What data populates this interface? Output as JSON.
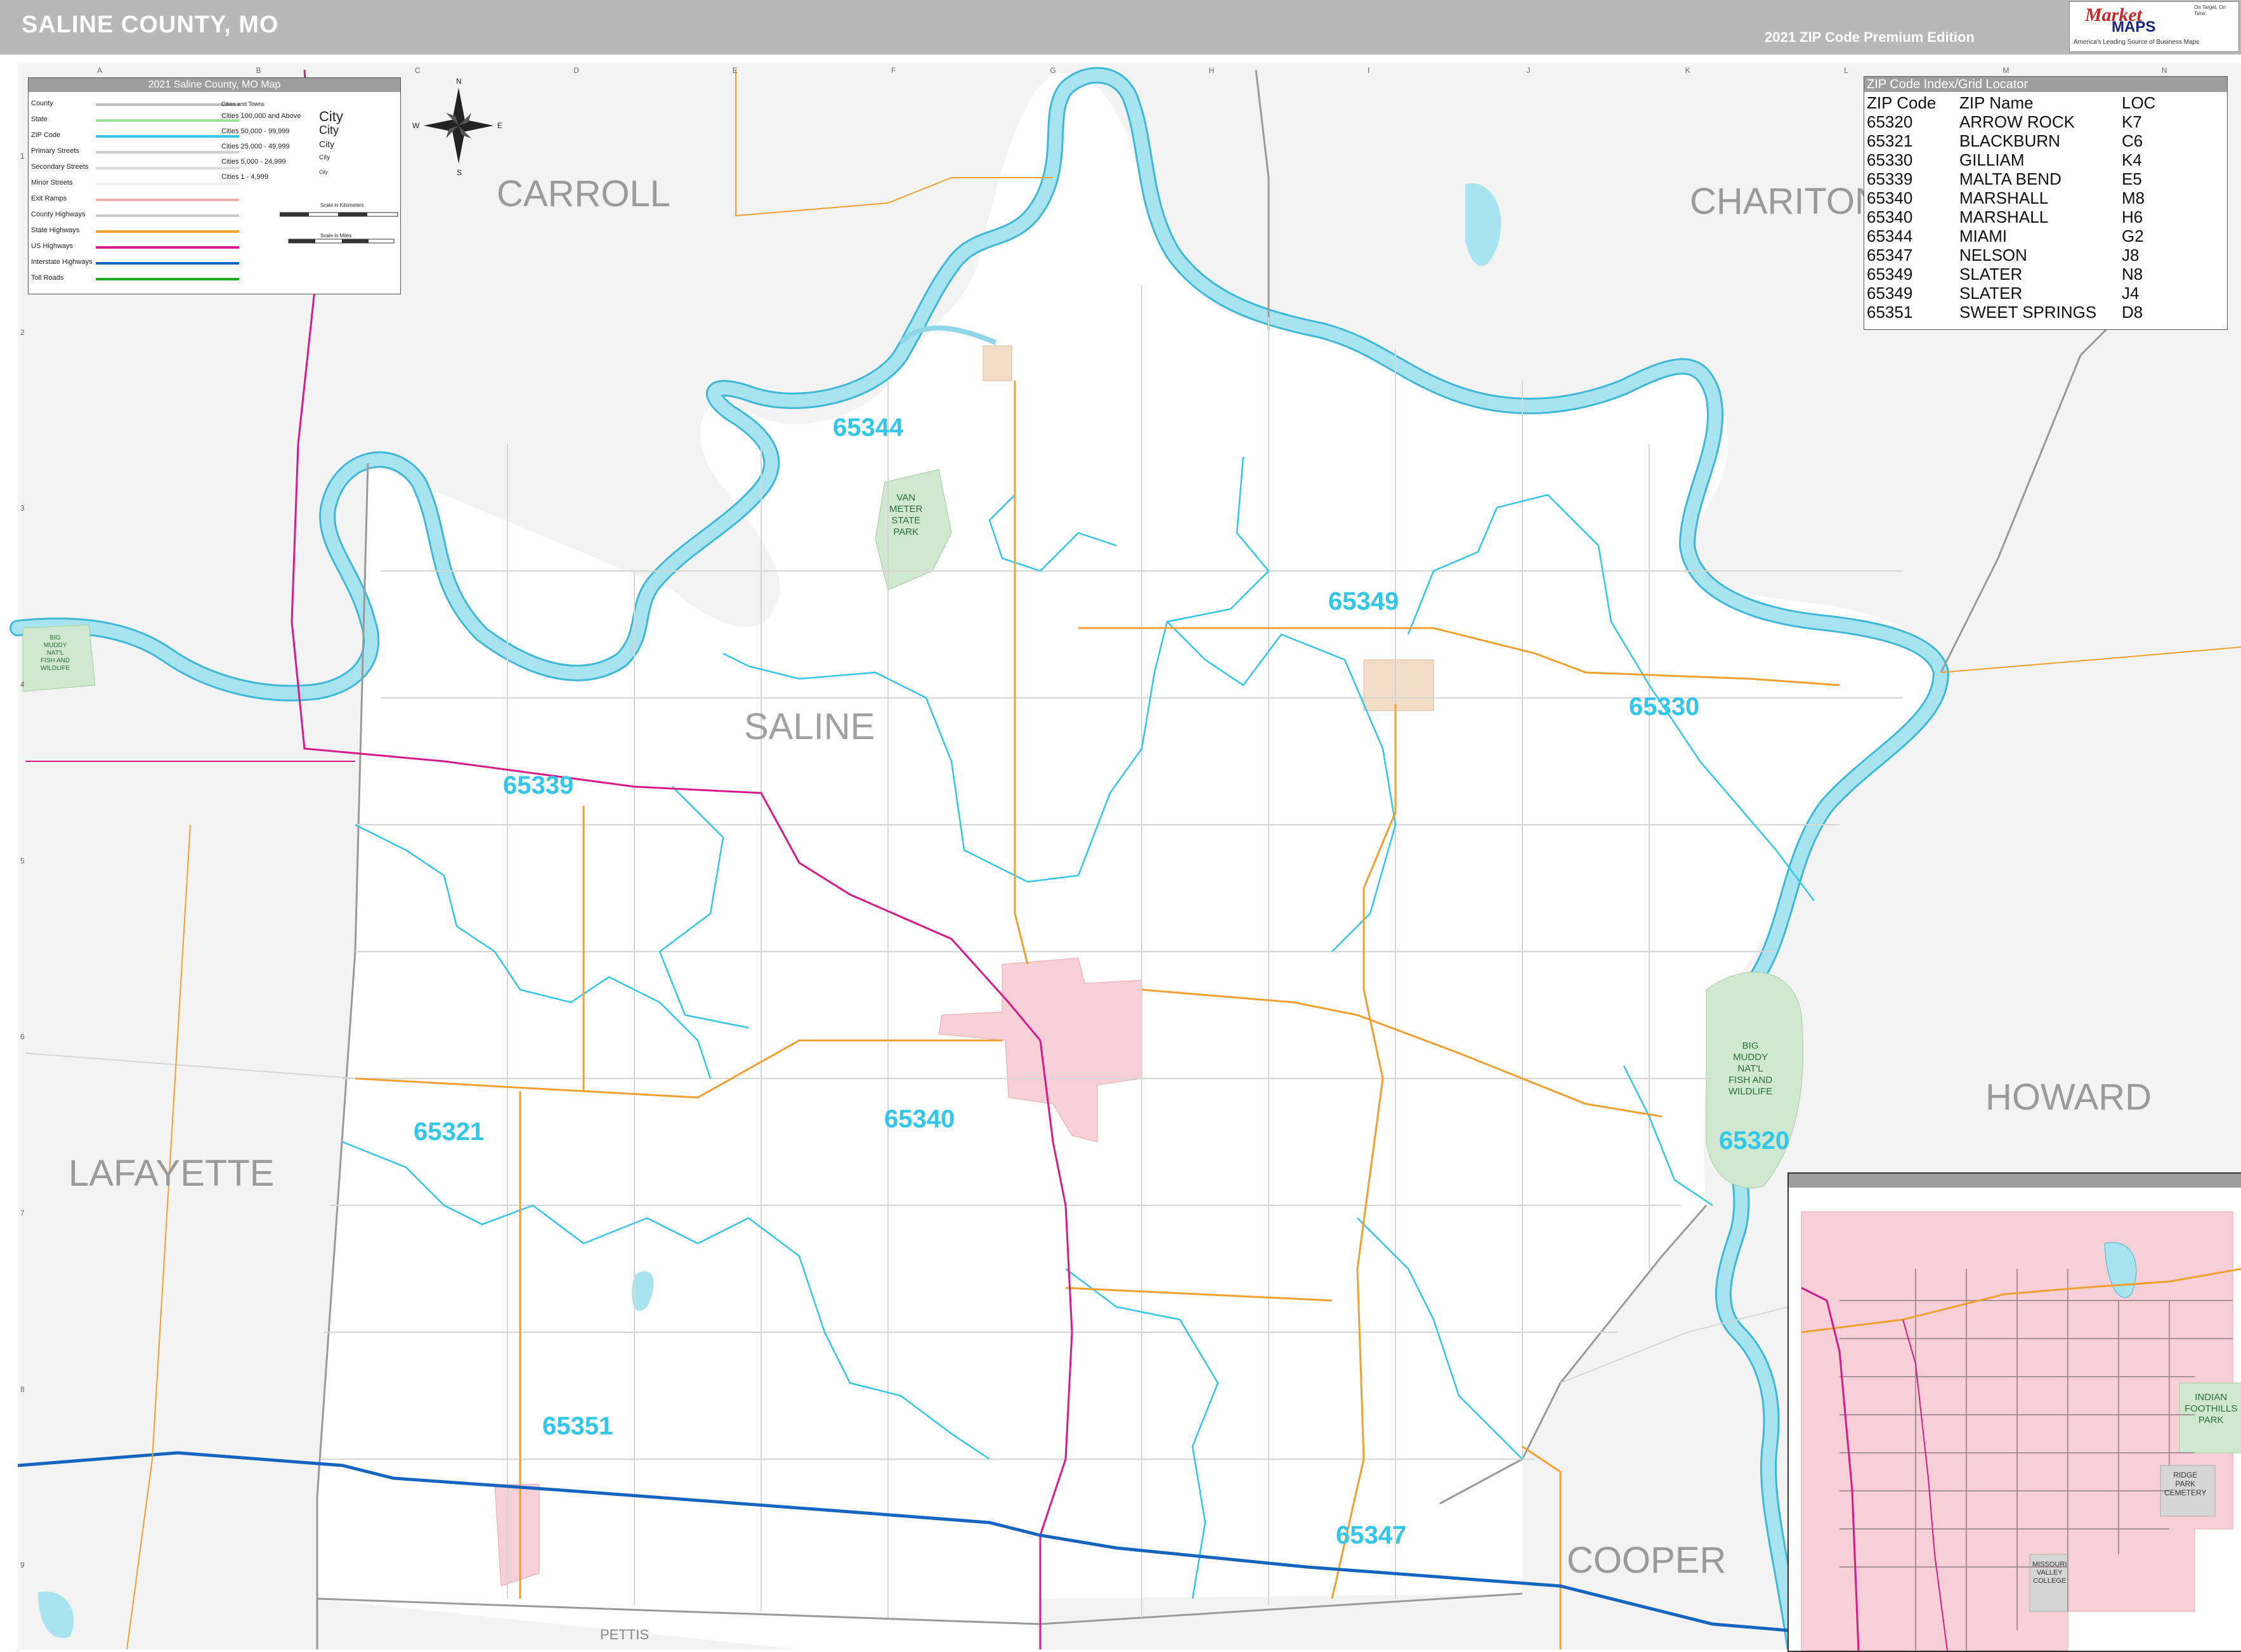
{
  "header": {
    "title": "SALINE COUNTY, MO",
    "edition": "2021 ZIP Code Premium Edition",
    "logo": {
      "brand_top": "Market",
      "brand_bottom": "MAPS",
      "tagline": "America's Leading Source of Business Maps",
      "slogan": "On Target. On Time."
    }
  },
  "legend": {
    "title": "2021 Saline County, MO Map",
    "lines": [
      {
        "label": "County",
        "color": "#bdbdbd"
      },
      {
        "label": "State",
        "color": "#9be39b"
      },
      {
        "label": "ZIP Code",
        "color": "#33c6e8"
      },
      {
        "label": "Primary Streets",
        "color": "#cfcfcf"
      },
      {
        "label": "Secondary Streets",
        "color": "#dedede"
      },
      {
        "label": "Minor Streets",
        "color": "#eeeeee"
      },
      {
        "label": "Exit Ramps",
        "color": "#f3b0b0"
      },
      {
        "label": "County Highways",
        "color": "#c8c8c8"
      },
      {
        "label": "State Highways",
        "color": "#f0a030"
      },
      {
        "label": "US Highways",
        "color": "#d81b8a"
      },
      {
        "label": "Interstate Highways",
        "color": "#1565c0"
      },
      {
        "label": "Toll Roads",
        "color": "#1faa1f"
      }
    ],
    "cities_header": "Cities and Towns",
    "cities": [
      {
        "label": "Cities 100,000 and Above",
        "symbol": "City"
      },
      {
        "label": "Cities 50,000 - 99,999",
        "symbol": "City"
      },
      {
        "label": "Cities 25,000 - 49,999",
        "symbol": "City"
      },
      {
        "label": "Cities 5,000 - 24,999",
        "symbol": "City"
      },
      {
        "label": "Cities 1 - 4,999",
        "symbol": "City"
      }
    ],
    "scale_km": "Scale in Kilometers",
    "scale_mi": "Scale in Miles"
  },
  "zip_index": {
    "title": "ZIP Code Index/Grid Locator",
    "headers": [
      "ZIP Code",
      "ZIP Name",
      "LOC"
    ],
    "rows": [
      [
        "65320",
        "ARROW ROCK",
        "K7"
      ],
      [
        "65321",
        "BLACKBURN",
        "C6"
      ],
      [
        "65330",
        "GILLIAM",
        "K4"
      ],
      [
        "65339",
        "MALTA BEND",
        "E5"
      ],
      [
        "65340",
        "MARSHALL",
        "M8"
      ],
      [
        "65340",
        "MARSHALL",
        "H6"
      ],
      [
        "65344",
        "MIAMI",
        "G2"
      ],
      [
        "65347",
        "NELSON",
        "J8"
      ],
      [
        "65349",
        "SLATER",
        "N8"
      ],
      [
        "65349",
        "SLATER",
        "J4"
      ],
      [
        "65351",
        "SWEET SPRINGS",
        "D8"
      ]
    ]
  },
  "compass": {
    "n": "N",
    "s": "S",
    "e": "E",
    "w": "W"
  },
  "counties": {
    "carroll": "CARROLL",
    "chariton": "CHARITON",
    "saline": "SALINE",
    "howard": "HOWARD",
    "lafayette": "LAFAYETTE",
    "cooper": "COOPER",
    "pettis": "PETTIS"
  },
  "zip_labels": {
    "z65344": "65344",
    "z65349": "65349",
    "z65330": "65330",
    "z65339": "65339",
    "z65340": "65340",
    "z65321": "65321",
    "z65320": "65320",
    "z65351": "65351",
    "z65347": "65347"
  },
  "parks": {
    "van_meter": "VAN\nMETER\nSTATE\nPARK",
    "big_muddy": "BIG\nMUDDY\nNAT'L\nFISH AND\nWILDLIFE",
    "big_muddy_west": "BIG\nMUDDY\nNAT'L\nFISH AND\nWILDLIFE",
    "indian_foothills": "INDIAN\nFOOTHILLS\nPARK",
    "ridge_park": "RIDGE\nPARK\nCEMETERY",
    "missouri_valley": "MISSOURI\nVALLEY\nCOLLEGE"
  },
  "grid": {
    "cols": [
      "A",
      "B",
      "C",
      "D",
      "E",
      "F",
      "G",
      "H",
      "I",
      "J",
      "K",
      "L",
      "M",
      "N"
    ],
    "rows": [
      "1",
      "2",
      "3",
      "4",
      "5",
      "6",
      "7",
      "8",
      "9"
    ]
  },
  "colors": {
    "river": "#a8e4f0",
    "river_edge": "#3fb8d8",
    "zip_boundary": "#33c6e8",
    "county_line": "#9a9a9a",
    "outside_fill": "#f2f2f2",
    "park": "#cfe8cf",
    "urban": "#f6d0d6",
    "interstate": "#1565c0",
    "us_highway": "#d81b8a",
    "state_highway": "#f0a030"
  }
}
